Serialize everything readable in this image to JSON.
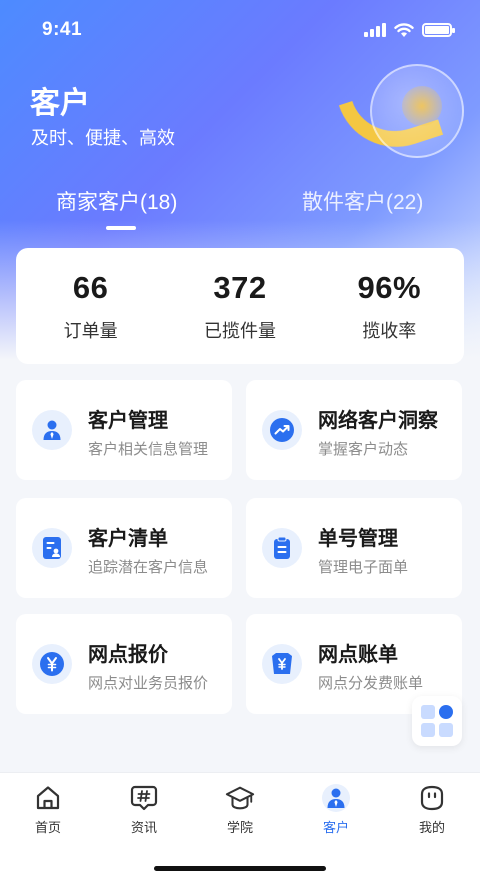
{
  "status_bar": {
    "time": "9:41"
  },
  "header": {
    "title": "客户",
    "subtitle": "及时、便捷、高效"
  },
  "tabs": [
    {
      "label": "商家客户(18)",
      "active": true
    },
    {
      "label": "散件客户(22)",
      "active": false
    }
  ],
  "stats": [
    {
      "value": "66",
      "label": "订单量"
    },
    {
      "value": "372",
      "label": "已揽件量"
    },
    {
      "value": "96%",
      "label": "揽收率"
    }
  ],
  "cards": [
    {
      "title": "客户管理",
      "subtitle": "客户相关信息管理",
      "icon": "customer-person-icon"
    },
    {
      "title": "网络客户洞察",
      "subtitle": "掌握客户动态",
      "icon": "trend-chart-icon"
    },
    {
      "title": "客户清单",
      "subtitle": "追踪潜在客户信息",
      "icon": "contact-list-icon"
    },
    {
      "title": "单号管理",
      "subtitle": "管理电子面单",
      "icon": "clipboard-icon"
    },
    {
      "title": "网点报价",
      "subtitle": "网点对业务员报价",
      "icon": "yen-coin-icon"
    },
    {
      "title": "网点账单",
      "subtitle": "网点分发费账单",
      "icon": "yen-bill-icon"
    }
  ],
  "tabbar": [
    {
      "label": "首页",
      "icon": "home-icon",
      "active": false
    },
    {
      "label": "资讯",
      "icon": "hashtag-message-icon",
      "active": false
    },
    {
      "label": "学院",
      "icon": "graduation-cap-icon",
      "active": false
    },
    {
      "label": "客户",
      "icon": "customer-person-icon",
      "active": true
    },
    {
      "label": "我的",
      "icon": "profile-face-icon",
      "active": false
    }
  ],
  "colors": {
    "accent": "#2b6fef",
    "icon_bg": "#e8f0fd",
    "hero_start": "#4d8bff",
    "hero_end": "#dbe7ff"
  }
}
